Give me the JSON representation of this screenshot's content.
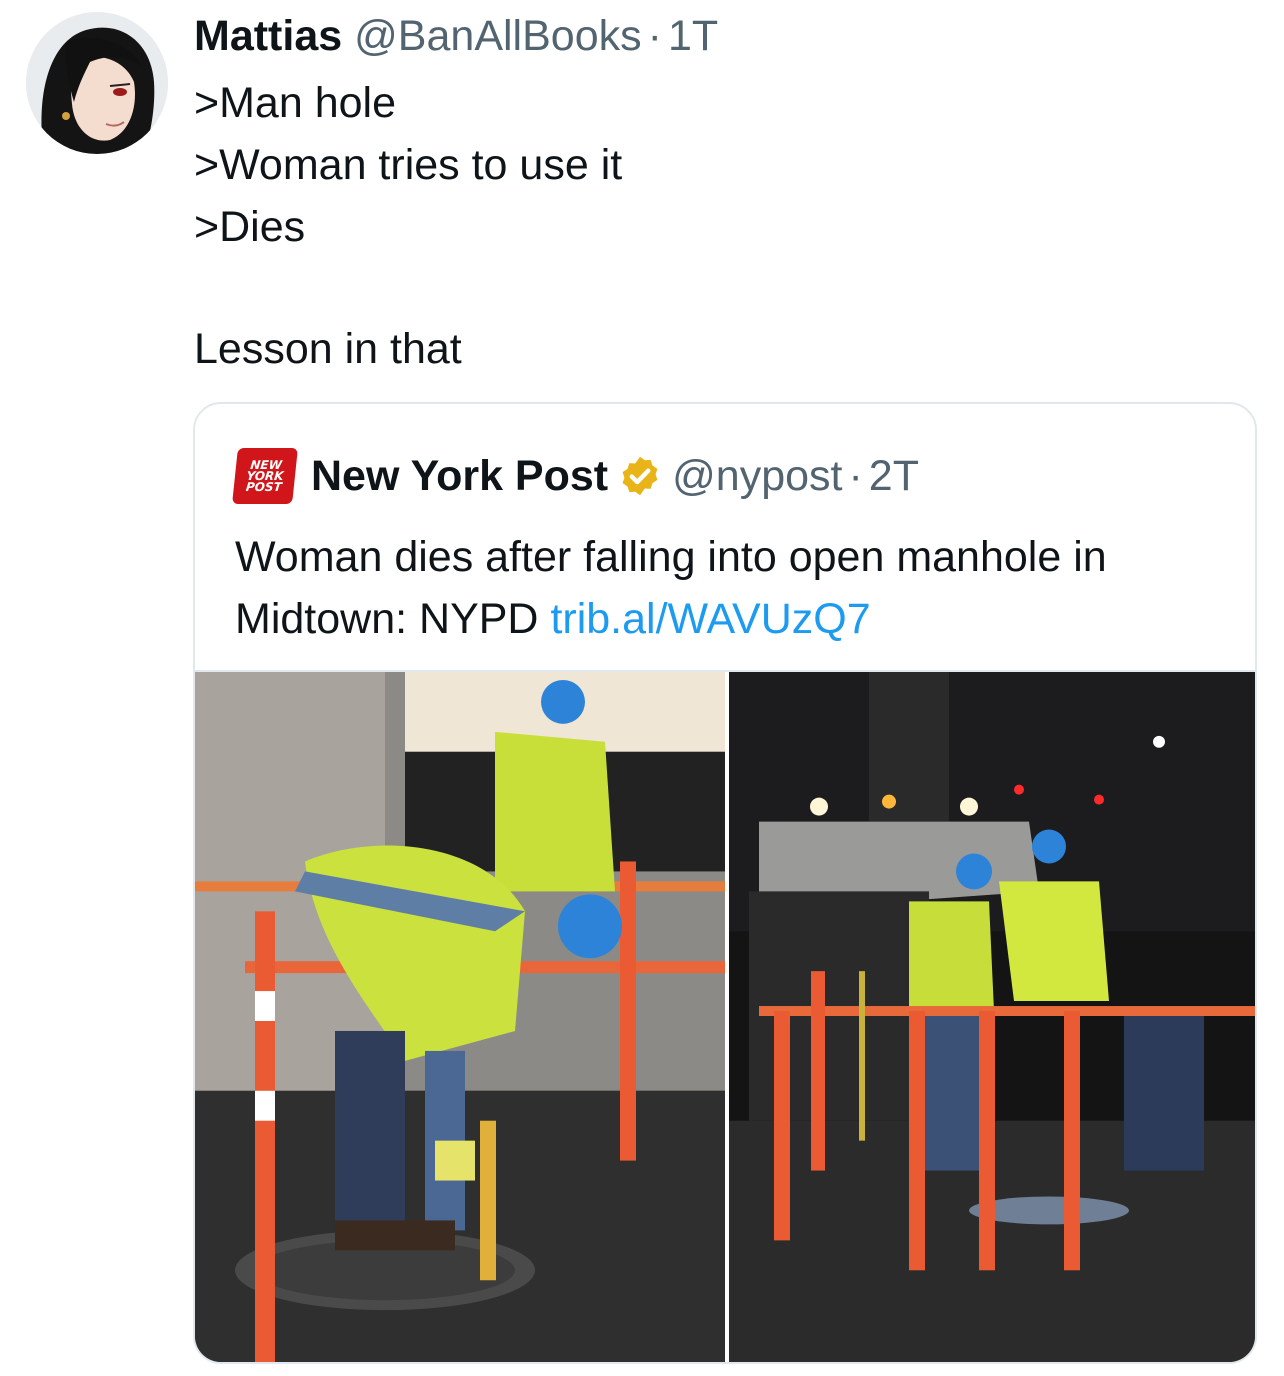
{
  "tweet": {
    "author": {
      "display_name": "Mattias",
      "handle": "@BanAllBooks",
      "separator": "·",
      "time": "1T",
      "avatar_icon": "anime-avatar"
    },
    "lines": [
      ">Man hole",
      ">Woman tries to use it",
      ">Dies",
      "Lesson in that"
    ]
  },
  "quote": {
    "logo_lines": [
      "NEW",
      "YORK",
      "POST"
    ],
    "logo_color": "#d0161a",
    "display_name": "New York Post",
    "verified_icon": "verified-badge-icon",
    "verified_color": "#e8b417",
    "handle": "@nypost",
    "separator": "·",
    "time": "2T",
    "text": "Woman dies after falling into open manhole in Midtown: NYPD ",
    "link": "trib.al/WAVUzQ7",
    "link_color": "#1d9bf0",
    "media": [
      {
        "icon": "photo-worker-at-manhole"
      },
      {
        "icon": "photo-night-crew-at-scene"
      }
    ]
  }
}
